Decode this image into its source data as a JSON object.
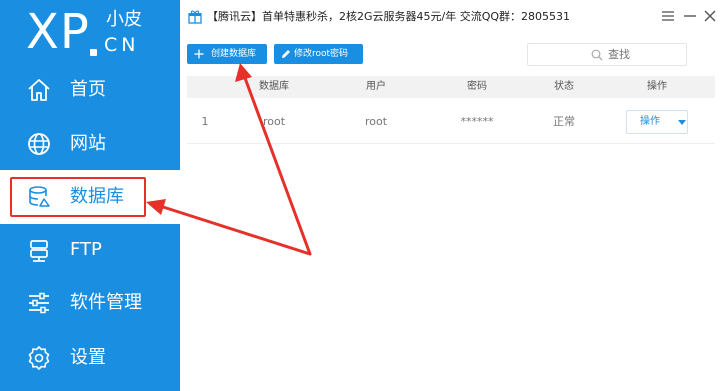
{
  "app": {
    "logo_main": "XP",
    "logo_sub_top": "小皮",
    "logo_sub_bottom": "CN"
  },
  "topbar": {
    "promo_text": "【腾讯云】首单特惠秒杀，2核2G云服务器45元/年 交流QQ群：2805531",
    "window_controls": [
      "menu-icon",
      "minimize-icon",
      "close-icon"
    ]
  },
  "sidebar": {
    "items": [
      {
        "label": "首页",
        "icon": "home-icon"
      },
      {
        "label": "网站",
        "icon": "globe-icon"
      },
      {
        "label": "数据库",
        "icon": "database-icon",
        "active": true
      },
      {
        "label": "FTP",
        "icon": "ftp-server-icon"
      },
      {
        "label": "软件管理",
        "icon": "sliders-icon"
      },
      {
        "label": "设置",
        "icon": "gear-icon"
      }
    ]
  },
  "toolbar": {
    "create_db_label": "创建数据库",
    "change_root_pwd_label": "修改root密码",
    "search_placeholder": "查找"
  },
  "table": {
    "headers": [
      "",
      "数据库",
      "用户",
      "密码",
      "状态",
      "操作"
    ],
    "rows": [
      {
        "index": "1",
        "database": "root",
        "user": "root",
        "password": "******",
        "status": "正常",
        "action": "操作"
      }
    ]
  },
  "colors": {
    "accent": "#1a8fe1",
    "highlight": "#e5312a"
  }
}
